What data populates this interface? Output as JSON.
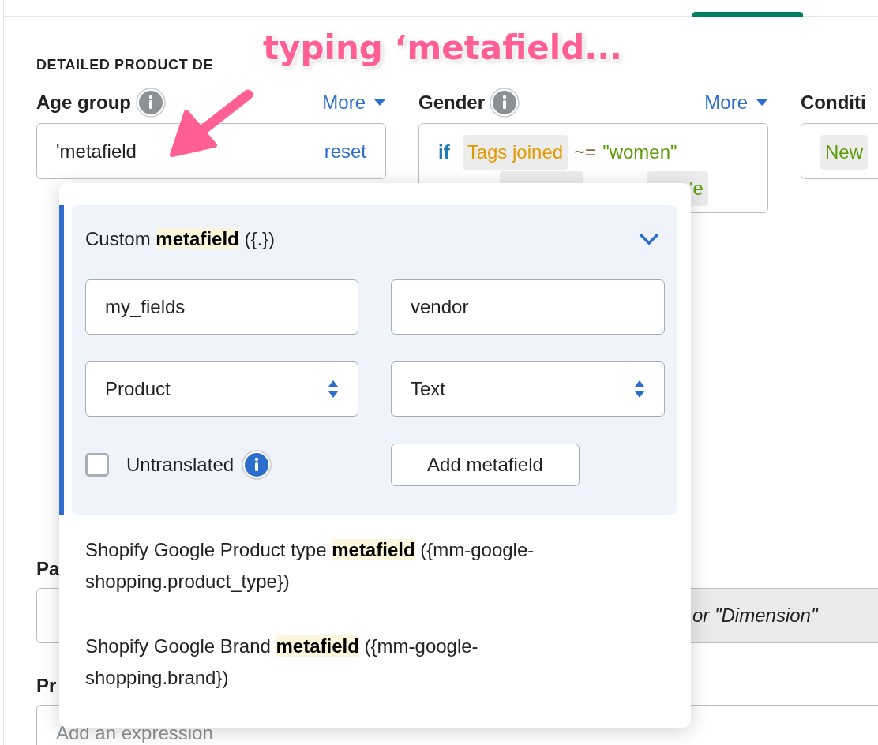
{
  "section_heading": "DETAILED PRODUCT DE",
  "fields": [
    {
      "label": "Age group",
      "more": "More",
      "kind": "input",
      "value": "'metafield",
      "action": "reset"
    },
    {
      "label": "Gender",
      "more": "More",
      "kind": "expression",
      "lines": [
        [
          {
            "kind": "keyword",
            "text": "if"
          },
          {
            "kind": "attribute",
            "text": "Tags joined"
          },
          {
            "kind": "operator",
            "text": "~="
          },
          {
            "kind": "string",
            "text": "\"women\""
          }
        ],
        [
          {
            "kind": "blank"
          },
          {
            "kind": "string_chip",
            "text": "'e"
          }
        ]
      ]
    },
    {
      "label": "Conditi",
      "kind": "expression",
      "lines": [
        [
          {
            "kind": "string_chip",
            "text": "New"
          }
        ]
      ]
    }
  ],
  "lower_fields": [
    {
      "label": "Pa",
      "hint": "or \"Dimension\""
    },
    {
      "label": "Pr",
      "placeholder": "Add an expression"
    }
  ],
  "popup": {
    "custom": {
      "title": "Custom **metafield** ({.})",
      "expanded": true,
      "inputs": [
        {
          "value": "my_fields"
        },
        {
          "value": "vendor"
        }
      ],
      "selects": [
        {
          "value": "Product"
        },
        {
          "value": "Text"
        }
      ],
      "checkbox": {
        "label": "Untranslated",
        "checked": false
      },
      "button": "Add metafield"
    },
    "options": [
      {
        "text": "Shopify Google Product type **metafield** ({mm-google-shopping.product_type})"
      },
      {
        "text": "Shopify Google Brand **metafield** ({mm-google-shopping.brand})"
      }
    ]
  },
  "annotation": {
    "text": "typing ‘metafield..."
  }
}
